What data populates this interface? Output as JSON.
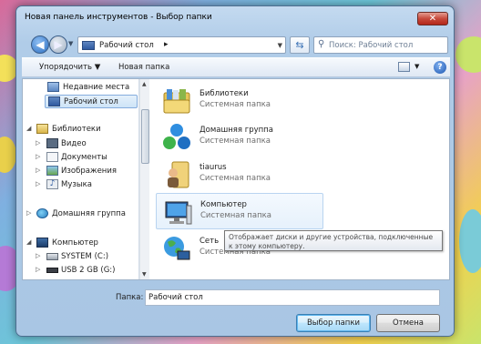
{
  "window": {
    "title": "Новая панель инструментов - Выбор папки",
    "close_label": "✕"
  },
  "address": {
    "path": "Рабочий стол",
    "separator": "▸"
  },
  "search": {
    "placeholder": "Поиск: Рабочий стол"
  },
  "toolbar": {
    "organize": "Упорядочить ▼",
    "new_folder": "Новая папка",
    "help": "?"
  },
  "nav": {
    "recent": "Недавние места",
    "desktop": "Рабочий стол",
    "libraries": "Библиотеки",
    "videos": "Видео",
    "documents": "Документы",
    "images": "Изображения",
    "music": "Музыка",
    "homegroup": "Домашняя группа",
    "computer": "Компьютер",
    "drive_c": "SYSTEM (C:)",
    "drive_g": "USB 2 GB (G:)"
  },
  "items": [
    {
      "name": "Библиотеки",
      "desc": "Системная папка",
      "icon": "libraries-icon"
    },
    {
      "name": "Домашняя группа",
      "desc": "Системная папка",
      "icon": "homegroup-icon"
    },
    {
      "name": "tiaurus",
      "desc": "Системная папка",
      "icon": "user-folder-icon"
    },
    {
      "name": "Компьютер",
      "desc": "Системная папка",
      "icon": "computer-icon"
    },
    {
      "name": "Сеть",
      "desc": "Системная папка",
      "icon": "network-icon"
    }
  ],
  "tooltip": "Отображает диски и другие устройства, подключенные к этому компьютеру.",
  "footer": {
    "folder_label": "Папка:",
    "folder_value": "Рабочий стол",
    "select_button": "Выбор папки",
    "cancel_button": "Отмена"
  }
}
